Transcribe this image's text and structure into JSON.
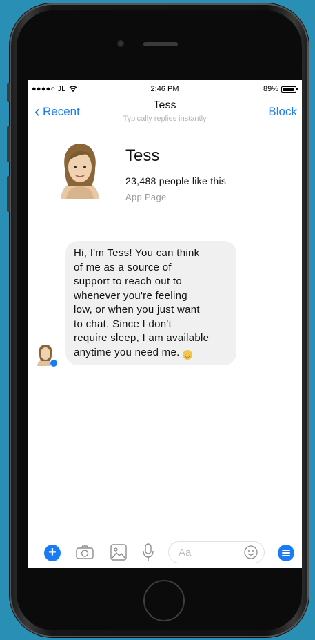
{
  "status_bar": {
    "carrier": "●●●●○ JL",
    "time": "2:46 PM",
    "battery_text": "89%",
    "battery_level": 0.89
  },
  "nav": {
    "back_label": "Recent",
    "title": "Tess",
    "subtitle": "Typically replies instantly",
    "block_label": "Block"
  },
  "profile": {
    "name": "Tess",
    "likes": "23,488 people like this",
    "type": "App Page"
  },
  "messages": [
    {
      "sender": "Tess",
      "text": "Hi, I'm Tess! You can think\nof me as a source of\nsupport to reach out to\nwhenever you're feeling\nlow, or when you just want\nto chat. Since I don't\nrequire sleep, I am available\nanytime you need me.",
      "emoji": "smiling-face"
    }
  ],
  "composer": {
    "placeholder": "Aa",
    "icons": [
      "plus-icon",
      "camera-icon",
      "image-icon",
      "microphone-icon",
      "emoji-icon",
      "menu-icon"
    ]
  },
  "colors": {
    "accent": "#1a7cf5",
    "background": "#2a8fb4",
    "bubble": "#f1f0f0"
  }
}
